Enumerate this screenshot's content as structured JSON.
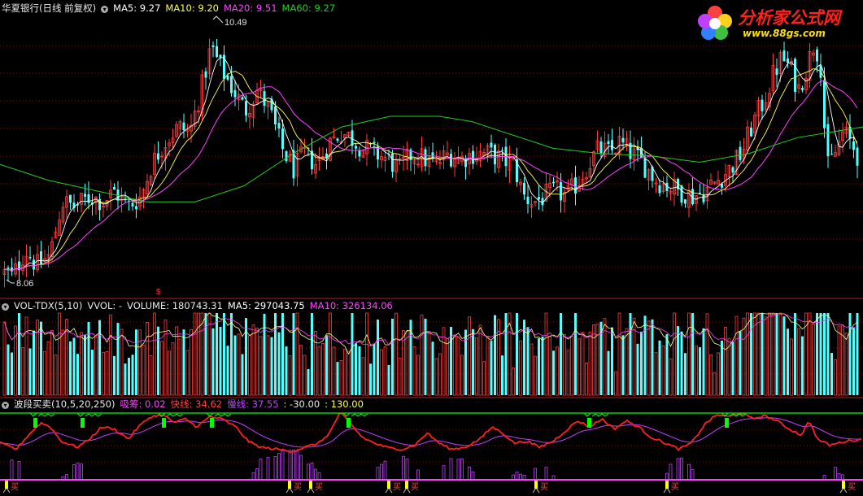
{
  "main_header": {
    "stock_name": "华夏银行(日线 前复权)",
    "ma5": "MA5: 9.27",
    "ma10": "MA10: 9.20",
    "ma20": "MA20: 9.51",
    "ma60": "MA60: 9.27"
  },
  "vol_header": {
    "name": "VOL-TDX(5,10)",
    "vvol": "VVOL: -",
    "volume": "VOLUME: 180743.31",
    "ma5": "MA5: 297043.75",
    "ma10": "MA10: 326134.06"
  },
  "ind_header": {
    "name": "波段买卖(10,5,20,250)",
    "xichou": "吸筹: 0.02",
    "fast": "快线: 34.62",
    "slow": "慢线: 37.55",
    "v1": ": -30.00",
    "v2": ": 130.00"
  },
  "logo": {
    "text": "分析家公式网",
    "url": "www.88gs.com"
  },
  "labels": {
    "high": "10.49",
    "low": "8.06",
    "buy_marker": "买"
  },
  "colors": {
    "up": "#ff3c3c",
    "down": "#54ffff",
    "ma5": "#ffffff",
    "ma10": "#ffff50",
    "ma20": "#ff40ff",
    "ma60": "#20d020",
    "grid": "#7a1010",
    "fast": "#ff2020",
    "slow": "#c040ff",
    "magenta": "#ff40ff",
    "green": "#00ff00",
    "yellow": "#ffff00"
  },
  "chart_data": [
    {
      "type": "candlestick",
      "title": "华夏银行(日线 前复权)",
      "ylim": [
        8.0,
        10.6
      ],
      "price_marks": {
        "high": 10.49,
        "low": 8.06
      },
      "series": [
        {
          "name": "MA5",
          "last": 9.27
        },
        {
          "name": "MA10",
          "last": 9.2
        },
        {
          "name": "MA20",
          "last": 9.51
        },
        {
          "name": "MA60",
          "last": 9.27
        }
      ],
      "close_path": [
        [
          0,
          8.2
        ],
        [
          14,
          8.15
        ],
        [
          30,
          8.4
        ],
        [
          44,
          8.25
        ],
        [
          60,
          8.35
        ],
        [
          75,
          8.85
        ],
        [
          90,
          8.8
        ],
        [
          110,
          8.9
        ],
        [
          125,
          8.85
        ],
        [
          140,
          8.95
        ],
        [
          155,
          8.8
        ],
        [
          172,
          8.9
        ],
        [
          185,
          9.2
        ],
        [
          200,
          9.4
        ],
        [
          218,
          9.55
        ],
        [
          232,
          9.5
        ],
        [
          246,
          9.9
        ],
        [
          258,
          10.3
        ],
        [
          270,
          10.1
        ],
        [
          285,
          9.9
        ],
        [
          300,
          9.7
        ],
        [
          315,
          9.9
        ],
        [
          330,
          9.7
        ],
        [
          345,
          9.35
        ],
        [
          360,
          9.15
        ],
        [
          372,
          9.3
        ],
        [
          388,
          9.2
        ],
        [
          403,
          9.4
        ],
        [
          418,
          9.5
        ],
        [
          430,
          9.45
        ],
        [
          445,
          9.35
        ],
        [
          460,
          9.3
        ],
        [
          475,
          9.25
        ],
        [
          490,
          9.15
        ],
        [
          505,
          9.3
        ],
        [
          520,
          9.25
        ],
        [
          535,
          9.2
        ],
        [
          550,
          9.3
        ],
        [
          565,
          9.25
        ],
        [
          580,
          9.3
        ],
        [
          600,
          9.3
        ],
        [
          615,
          9.25
        ],
        [
          630,
          9.2
        ],
        [
          642,
          8.9
        ],
        [
          655,
          8.85
        ],
        [
          668,
          8.9
        ],
        [
          682,
          8.95
        ],
        [
          696,
          8.9
        ],
        [
          710,
          9.05
        ],
        [
          722,
          9.2
        ],
        [
          735,
          9.35
        ],
        [
          748,
          9.3
        ],
        [
          760,
          9.4
        ],
        [
          775,
          9.3
        ],
        [
          790,
          9.2
        ],
        [
          805,
          9.05
        ],
        [
          820,
          9.0
        ],
        [
          835,
          8.95
        ],
        [
          850,
          8.9
        ],
        [
          865,
          8.95
        ],
        [
          880,
          9.05
        ],
        [
          895,
          9.15
        ],
        [
          910,
          9.3
        ],
        [
          925,
          9.6
        ],
        [
          938,
          9.8
        ],
        [
          950,
          10.05
        ],
        [
          960,
          10.2
        ],
        [
          970,
          10.1
        ],
        [
          980,
          9.9
        ],
        [
          990,
          10.1
        ],
        [
          1000,
          10.35
        ],
        [
          1008,
          10.1
        ],
        [
          1015,
          9.15
        ],
        [
          1025,
          9.3
        ],
        [
          1035,
          9.5
        ],
        [
          1045,
          9.4
        ],
        [
          1055,
          9.25
        ]
      ],
      "ma60_path": [
        [
          0,
          9.2
        ],
        [
          60,
          9.05
        ],
        [
          120,
          8.95
        ],
        [
          180,
          8.85
        ],
        [
          240,
          8.85
        ],
        [
          300,
          9.0
        ],
        [
          360,
          9.3
        ],
        [
          420,
          9.55
        ],
        [
          480,
          9.65
        ],
        [
          540,
          9.65
        ],
        [
          580,
          9.6
        ],
        [
          620,
          9.5
        ],
        [
          680,
          9.35
        ],
        [
          740,
          9.3
        ],
        [
          800,
          9.28
        ],
        [
          860,
          9.22
        ],
        [
          920,
          9.3
        ],
        [
          980,
          9.45
        ],
        [
          1061,
          9.55
        ]
      ]
    },
    {
      "type": "bar",
      "title": "VOL-TDX(5,10)",
      "series": [
        {
          "name": "VOLUME",
          "last": 180743.31
        },
        {
          "name": "MA5",
          "last": 297043.75
        },
        {
          "name": "MA10",
          "last": 326134.06
        }
      ]
    },
    {
      "type": "line",
      "title": "波段买卖(10,5,20,250)",
      "ylim": [
        -30,
        130
      ],
      "series": [
        {
          "name": "吸筹",
          "last": 0.02
        },
        {
          "name": "快线",
          "last": 34.62
        },
        {
          "name": "慢线",
          "last": 37.55
        }
      ],
      "fast_path": [
        [
          0,
          20
        ],
        [
          20,
          5
        ],
        [
          35,
          40
        ],
        [
          50,
          70
        ],
        [
          62,
          60
        ],
        [
          75,
          25
        ],
        [
          95,
          10
        ],
        [
          110,
          30
        ],
        [
          125,
          60
        ],
        [
          140,
          55
        ],
        [
          158,
          30
        ],
        [
          170,
          60
        ],
        [
          185,
          85
        ],
        [
          200,
          90
        ],
        [
          215,
          70
        ],
        [
          228,
          80
        ],
        [
          242,
          60
        ],
        [
          258,
          85
        ],
        [
          272,
          80
        ],
        [
          290,
          60
        ],
        [
          305,
          25
        ],
        [
          320,
          10
        ],
        [
          340,
          5
        ],
        [
          360,
          0
        ],
        [
          375,
          10
        ],
        [
          392,
          20
        ],
        [
          405,
          45
        ],
        [
          418,
          95
        ],
        [
          430,
          70
        ],
        [
          445,
          35
        ],
        [
          460,
          20
        ],
        [
          478,
          8
        ],
        [
          495,
          5
        ],
        [
          510,
          15
        ],
        [
          525,
          45
        ],
        [
          540,
          20
        ],
        [
          555,
          5
        ],
        [
          572,
          10
        ],
        [
          590,
          30
        ],
        [
          605,
          60
        ],
        [
          618,
          45
        ],
        [
          632,
          20
        ],
        [
          648,
          25
        ],
        [
          663,
          10
        ],
        [
          680,
          25
        ],
        [
          695,
          50
        ],
        [
          710,
          75
        ],
        [
          725,
          60
        ],
        [
          740,
          80
        ],
        [
          755,
          55
        ],
        [
          770,
          75
        ],
        [
          785,
          60
        ],
        [
          800,
          35
        ],
        [
          818,
          20
        ],
        [
          835,
          5
        ],
        [
          850,
          20
        ],
        [
          868,
          70
        ],
        [
          882,
          90
        ],
        [
          896,
          85
        ],
        [
          910,
          95
        ],
        [
          925,
          80
        ],
        [
          940,
          88
        ],
        [
          955,
          75
        ],
        [
          970,
          55
        ],
        [
          985,
          40
        ],
        [
          995,
          75
        ],
        [
          1005,
          30
        ],
        [
          1020,
          15
        ],
        [
          1040,
          25
        ],
        [
          1061,
          30
        ]
      ]
    }
  ]
}
